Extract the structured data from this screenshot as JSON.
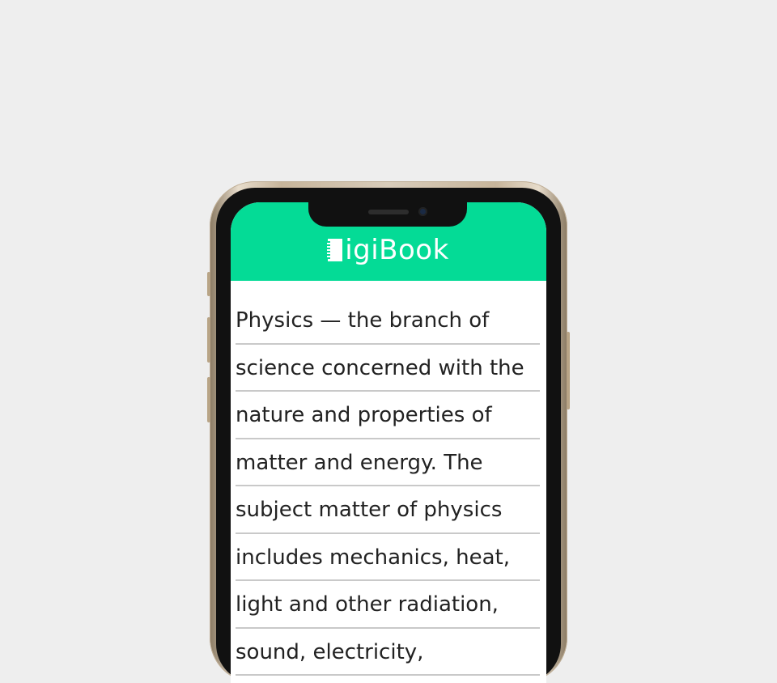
{
  "app": {
    "title": "igiBook"
  },
  "reader": {
    "lines": [
      "Physics — the branch of",
      "science concerned with the",
      "nature and properties of",
      "matter and energy. The",
      "subject matter of physics",
      "includes mechanics, heat,",
      "light and other radiation,",
      "sound, electricity,"
    ]
  },
  "colors": {
    "accent": "#04db96",
    "background": "#eeeeee",
    "text": "#222222"
  }
}
